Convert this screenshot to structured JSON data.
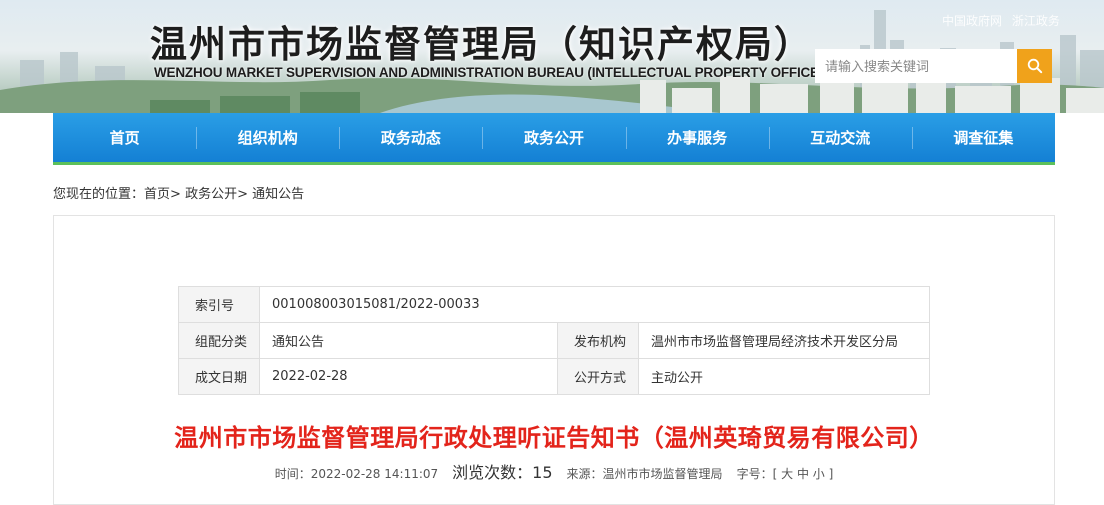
{
  "header": {
    "title": "温州市市场监督管理局（知识产权局）",
    "subtitle": "WENZHOU MARKET SUPERVISION AND ADMINISTRATION BUREAU (INTELLECTUAL PROPERTY OFFICE)",
    "top_links": [
      "中国政府网",
      "浙江政务"
    ],
    "search_placeholder": "请输入搜索关键词",
    "search_icon": "search-icon"
  },
  "nav": {
    "items": [
      "首页",
      "组织机构",
      "政务动态",
      "政务公开",
      "办事服务",
      "互动交流",
      "调查征集"
    ]
  },
  "breadcrumb": {
    "prefix": "您现在的位置：",
    "items": [
      "首页",
      "政务公开",
      "通知公告"
    ],
    "separator": ">"
  },
  "meta": {
    "index_label": "索引号",
    "index_value": "001008003015081/2022-00033",
    "category_label": "组配分类",
    "category_value": "通知公告",
    "publisher_label": "发布机构",
    "publisher_value": "温州市市场监督管理局经济技术开发区分局",
    "date_label": "成文日期",
    "date_value": "2022-02-28",
    "disclosure_label": "公开方式",
    "disclosure_value": "主动公开"
  },
  "article": {
    "title": "温州市市场监督管理局行政处理听证告知书（温州英琦贸易有限公司）",
    "time_label": "时间：",
    "time_value": "2022-02-28 14:11:07",
    "views_label": "浏览次数：",
    "views_value": "15",
    "source_label": "来源：",
    "source_value": "温州市市场监督管理局",
    "fontsize_label": "字号：",
    "font_open": "[",
    "font_large": "大",
    "font_medium": "中",
    "font_small": "小",
    "font_close": "]"
  },
  "colors": {
    "nav_blue": "#1a8cdc",
    "nav_accent": "#5cc05a",
    "search_orange": "#f0a21b",
    "title_red": "#e3241b"
  }
}
